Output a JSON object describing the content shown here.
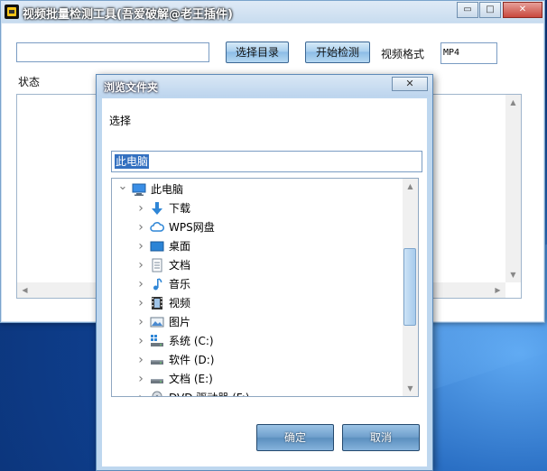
{
  "main_window": {
    "title": "视频批量检测工具(吾爱破解@老王插件)",
    "controls": {
      "minimize": "▭",
      "maximize": "□",
      "close": "✕"
    },
    "path_value": "",
    "select_dir_button": "选择目录",
    "start_button": "开始检测",
    "format_label": "视频格式",
    "format_value": "MP4",
    "status_label": "状态"
  },
  "dialog": {
    "title": "浏览文件夹",
    "close": "✕",
    "prompt": "选择",
    "selected_value": "此电脑",
    "tree": [
      {
        "label": "此电脑",
        "icon": "computer-icon",
        "expanded": true
      },
      {
        "label": "下载",
        "icon": "download-arrow-icon"
      },
      {
        "label": "WPS网盘",
        "icon": "cloud-icon"
      },
      {
        "label": "桌面",
        "icon": "desktop-icon"
      },
      {
        "label": "文档",
        "icon": "document-icon"
      },
      {
        "label": "音乐",
        "icon": "music-note-icon"
      },
      {
        "label": "视频",
        "icon": "film-icon"
      },
      {
        "label": "图片",
        "icon": "picture-icon"
      },
      {
        "label": "系统 (C:)",
        "icon": "windows-drive-icon"
      },
      {
        "label": "软件 (D:)",
        "icon": "drive-icon"
      },
      {
        "label": "文档 (E:)",
        "icon": "drive-icon"
      },
      {
        "label": "DVD 驱动器 (F:)",
        "icon": "dvd-drive-icon"
      }
    ],
    "ok_button": "确定",
    "cancel_button": "取消"
  },
  "colors": {
    "accent": "#3370c0",
    "button_blue": "#6f9fcc",
    "window_frame": "#cfe0f1"
  }
}
